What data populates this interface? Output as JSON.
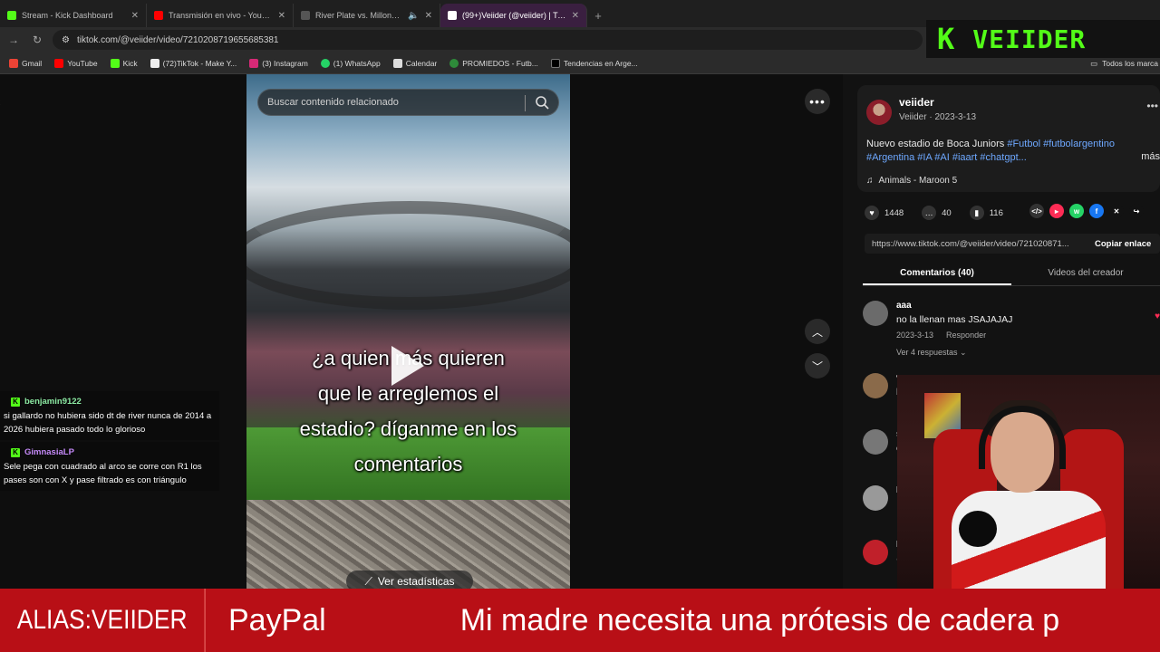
{
  "browser": {
    "tabs": [
      {
        "title": "Stream - Kick Dashboard",
        "fav_color": "#53fc18",
        "active": false
      },
      {
        "title": "Transmisión en vivo - YouTube",
        "fav_color": "#ff0000",
        "active": false
      },
      {
        "title": "River Plate vs. Millonarios |",
        "fav_color": "#555555",
        "active": false
      },
      {
        "title": "(99+)Veiider (@veiider) | TikTok",
        "fav_color": "#ffffff",
        "active": true
      }
    ],
    "url": "tiktok.com/@veiider/video/7210208719655685381",
    "bookmarks": [
      "Gmail",
      "YouTube",
      "Kick",
      "(72)TikTok - Make Y...",
      "(3) Instagram",
      "(1) WhatsApp",
      "Calendar",
      "PROMIEDOS - Futb...",
      "Tendencias en Arge..."
    ],
    "bookmarks_right": "Todos los marca"
  },
  "overlay": {
    "logo_k": "K",
    "logo_name": "VEIIDER"
  },
  "video": {
    "search_placeholder": "Buscar contenido relacionado",
    "caption_lines": [
      "¿a quien más quieren",
      "que le arreglemos el",
      "estadio? díganme en los",
      "comentarios"
    ],
    "stats_label": "Ver estadísticas"
  },
  "chat": [
    {
      "user": "benjamin9122",
      "user_color": "#8be9a2",
      "text": "si gallardo no hubiera sido dt de river nunca de 2014 a 2026 hubiera pasado todo lo glorioso"
    },
    {
      "user": "GimnasiaLP",
      "user_color": "#c58af9",
      "text": "Sele pega con cuadrado al arco se corre con R1 los pases son con X y pase filtrado es con triángulo"
    }
  ],
  "post": {
    "username": "veiider",
    "meta": "Veiider · 2023-3-13",
    "desc_text": "Nuevo estadio de Boca Juniors ",
    "tags_line1": [
      "#Futbol",
      "#futbolargentino"
    ],
    "tags_line2": [
      "#Argentina",
      "#IA",
      "#AI",
      "#iaart",
      "#chatgpt..."
    ],
    "more": "más",
    "music": "Animals - Maroon 5",
    "likes": "1448",
    "comments": "40",
    "saves": "116",
    "link": "https://www.tiktok.com/@veiider/video/721020871...",
    "copy_label": "Copiar enlace",
    "tab_comments": "Comentarios (40)",
    "tab_videos": "Videos del creador"
  },
  "comments": [
    {
      "name": "aaa",
      "text": "no la llenan mas JSAJAJAJ",
      "date": "2023-3-13",
      "reply": "Responder",
      "more": "Ver 4 respuestas"
    },
    {
      "name": "v",
      "text": "h",
      "date": "",
      "reply": "",
      "more": ""
    },
    {
      "name": "s",
      "text": "c",
      "date": "",
      "reply": "",
      "more": ""
    },
    {
      "name": "M",
      "text": "",
      "date": "",
      "reply": "",
      "more": ""
    },
    {
      "name": "E",
      "text": "@",
      "date": "",
      "reply": "",
      "more": ""
    }
  ],
  "banner": {
    "alias": "ALIAS:VEIIDER",
    "ticker1": "PayPal",
    "ticker2": "Mi madre necesita una prótesis de cadera p"
  }
}
